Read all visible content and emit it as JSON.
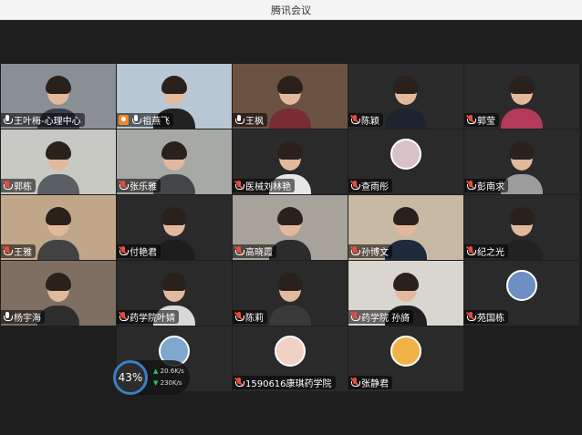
{
  "window": {
    "title": "腾讯会议"
  },
  "participants": [
    {
      "name": "王叶梅-心理中心",
      "muted": false,
      "host": false,
      "video": true,
      "bg": "#8a8f96",
      "shirt": "#3b3f4a"
    },
    {
      "name": "祖燕飞",
      "muted": false,
      "host": true,
      "video": true,
      "bg": "#b9c7d4",
      "shirt": "#222"
    },
    {
      "name": "王枫",
      "muted": false,
      "host": false,
      "video": true,
      "bg": "#6b5142",
      "shirt": "#7a2c35"
    },
    {
      "name": "陈颖",
      "muted": true,
      "host": false,
      "video": true,
      "bg": "#2a2a2a",
      "shirt": "#1d2430"
    },
    {
      "name": "郭莹",
      "muted": true,
      "host": false,
      "video": true,
      "bg": "#2a2a2a",
      "shirt": "#b33a58"
    },
    {
      "name": "郭栋",
      "muted": true,
      "host": false,
      "video": true,
      "bg": "#c9c9c4",
      "shirt": "#5a5f63"
    },
    {
      "name": "张乐雅",
      "muted": true,
      "host": false,
      "video": true,
      "bg": "#a7a9a5",
      "shirt": "#45464a"
    },
    {
      "name": "医械刘林艳",
      "muted": true,
      "host": false,
      "video": true,
      "bg": "#2a2a2a",
      "shirt": "#e6e6e6"
    },
    {
      "name": "查雨彤",
      "muted": true,
      "host": false,
      "video": false,
      "bg": "#2a2a2a",
      "avatar": "#d9c1c8"
    },
    {
      "name": "彭南求",
      "muted": true,
      "host": false,
      "video": true,
      "bg": "#2a2a2a",
      "shirt": "#9c9c9c"
    },
    {
      "name": "王雅",
      "muted": true,
      "host": false,
      "video": true,
      "bg": "#c0a78a",
      "shirt": "#424242"
    },
    {
      "name": "付艳君",
      "muted": true,
      "host": false,
      "video": true,
      "bg": "#2a2a2a",
      "shirt": "#1d1d1d"
    },
    {
      "name": "高晓霞",
      "muted": true,
      "host": false,
      "video": true,
      "bg": "#a8a39a",
      "shirt": "#2c2c2c"
    },
    {
      "name": "孙博文",
      "muted": true,
      "host": false,
      "video": true,
      "bg": "#c7b9a3",
      "shirt": "#1f2a3c"
    },
    {
      "name": "纪之光",
      "muted": true,
      "host": false,
      "video": true,
      "bg": "#2a2a2a",
      "shirt": "#222"
    },
    {
      "name": "杨宇海",
      "muted": false,
      "host": false,
      "video": true,
      "bg": "#7f6f62",
      "shirt": "#2d2d2d"
    },
    {
      "name": "药学院叶婧",
      "muted": true,
      "host": false,
      "video": true,
      "bg": "#2a2a2a",
      "shirt": "#d9d9d9"
    },
    {
      "name": "陈莉",
      "muted": true,
      "host": false,
      "video": true,
      "bg": "#2a2a2a",
      "shirt": "#3a3a3a"
    },
    {
      "name": "药学院 孙旖",
      "muted": true,
      "host": false,
      "video": true,
      "bg": "#d9d6d0",
      "shirt": "#1f1f1f"
    },
    {
      "name": "苑国栋",
      "muted": true,
      "host": false,
      "video": false,
      "bg": "#2a2a2a",
      "avatar": "#6e8fc4"
    }
  ],
  "last_row": [
    {
      "name": "",
      "muted": true,
      "host": false,
      "video": false,
      "bg": "#2a2a2a",
      "avatar": "#7fa8cf"
    },
    {
      "name": "1590616康琪药学院",
      "muted": true,
      "host": false,
      "video": false,
      "bg": "#2a2a2a",
      "avatar": "#f0d2c4"
    },
    {
      "name": "张静君",
      "muted": true,
      "host": false,
      "video": false,
      "bg": "#2a2a2a",
      "avatar": "#f2b24a"
    }
  ],
  "network": {
    "percent": "43%",
    "up": "20.6K/s",
    "down": "230K/s"
  }
}
